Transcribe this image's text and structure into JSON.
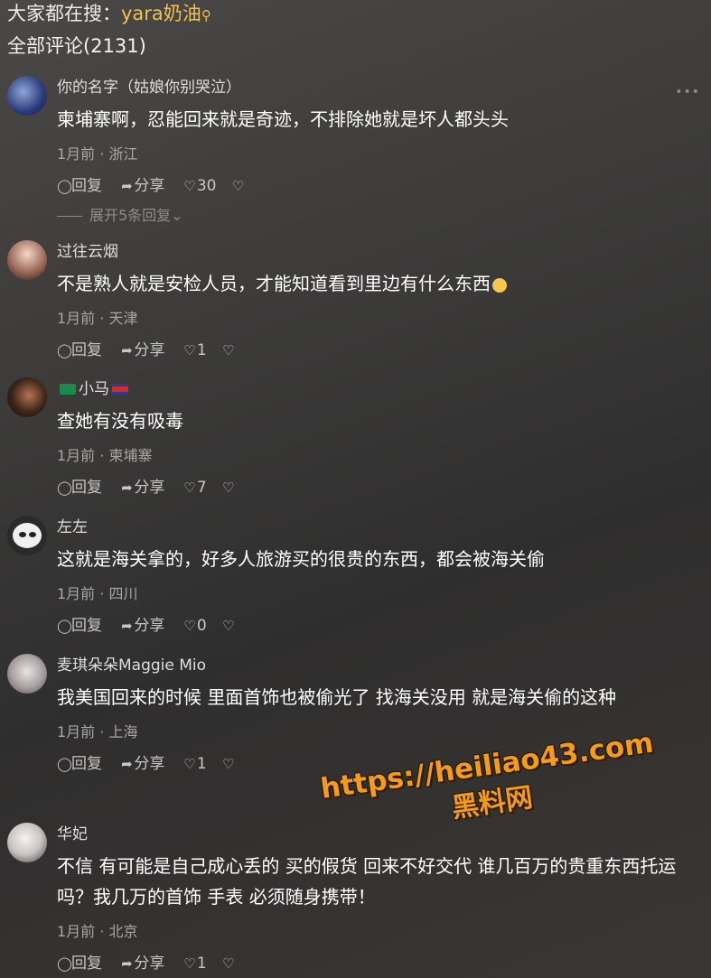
{
  "header": {
    "search_prefix": "大家都在搜：",
    "search_keyword": "yara奶油",
    "comment_count_label": "全部评论(2131)"
  },
  "comments": [
    {
      "username": "你的名字（姑娘你别哭泣）",
      "text": "柬埔寨啊，忍能回来就是奇迹，不排除她就是坏人都头头",
      "meta": "1月前 · 浙江",
      "reply_label": "回复",
      "share_label": "分享",
      "likes": "30",
      "expand_label": "展开5条回复"
    },
    {
      "username": "过往云烟",
      "text": "不是熟人就是安检人员，才能知道看到里边有什么东西",
      "meta": "1月前 · 天津",
      "reply_label": "回复",
      "share_label": "分享",
      "likes": "1"
    },
    {
      "username": "小马",
      "text": "查她有没有吸毒",
      "meta": "1月前 · 柬埔寨",
      "reply_label": "回复",
      "share_label": "分享",
      "likes": "7"
    },
    {
      "username": "左左",
      "text": "这就是海关拿的，好多人旅游买的很贵的东西，都会被海关偷",
      "meta": "1月前 · 四川",
      "reply_label": "回复",
      "share_label": "分享",
      "likes": "0"
    },
    {
      "username": "麦琪朵朵Maggie Mio",
      "text": "我美国回来的时候 里面首饰也被偷光了 找海关没用 就是海关偷的这种",
      "meta": "1月前 · 上海",
      "reply_label": "回复",
      "share_label": "分享",
      "likes": "1"
    },
    {
      "username": "华妃",
      "text": "不信 有可能是自己成心丢的 买的假货 回来不好交代 谁几百万的贵重东西托运吗？我几万的首饰 手表 必须随身携带！",
      "meta": "1月前 · 北京",
      "reply_label": "回复",
      "share_label": "分享",
      "likes": "1"
    }
  ],
  "watermark": {
    "url": "https://heiliao43.com",
    "name": "黑料网"
  },
  "colors": {
    "keyword": "#f2c14e",
    "watermark": "#f59b1c"
  },
  "icons": [
    "search-icon",
    "comment-icon",
    "share-icon",
    "heart-icon",
    "dislike-icon",
    "more-icon",
    "chevron-down-icon"
  ]
}
